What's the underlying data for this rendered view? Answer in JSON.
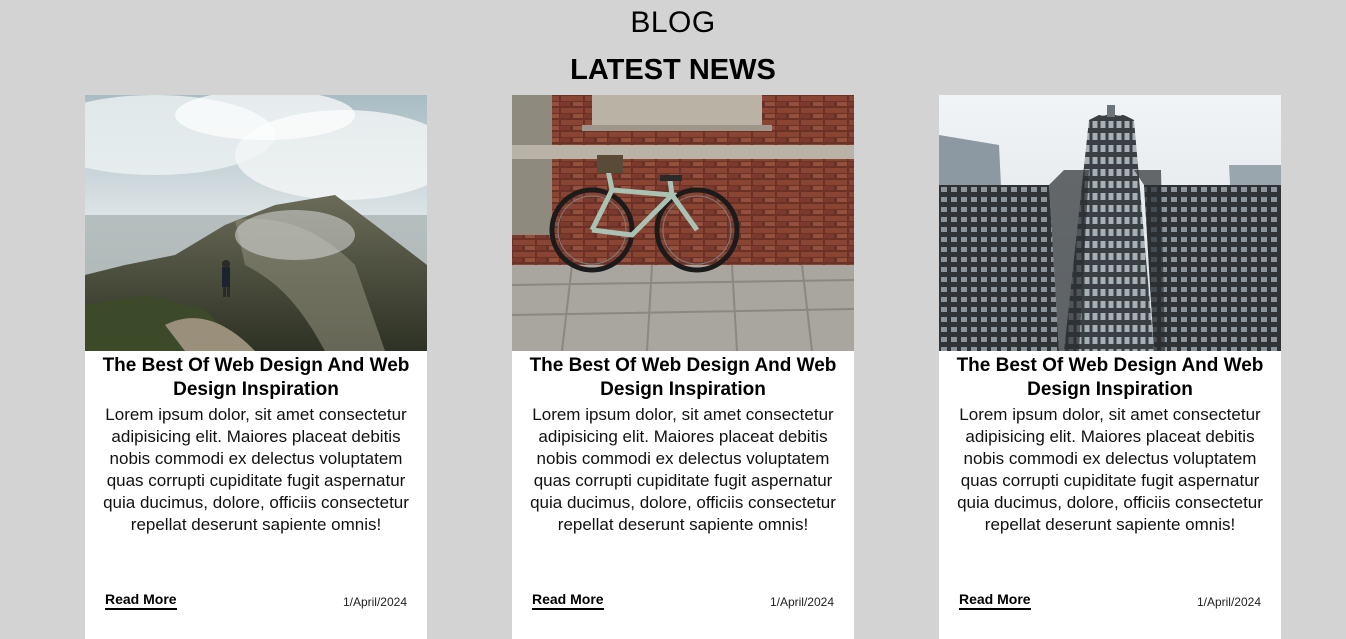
{
  "header": {
    "kicker": "BLOG",
    "title": "LATEST NEWS"
  },
  "cards": [
    {
      "image_subject": "hiker-on-mountain-trail",
      "title": "The Best Of Web Design And Web Design Inspiration",
      "body": "Lorem ipsum dolor, sit amet consectetur adipisicing elit. Maiores placeat debitis nobis commodi ex delectus voluptatem quas corrupti cupiditate fugit aspernatur quia ducimus, dolore, officiis consectetur repellat deserunt sapiente omnis!",
      "read_more": "Read More",
      "date": "1/April/2024"
    },
    {
      "image_subject": "bicycle-against-brick-wall",
      "title": "The Best Of Web Design And Web Design Inspiration",
      "body": "Lorem ipsum dolor, sit amet consectetur adipisicing elit. Maiores placeat debitis nobis commodi ex delectus voluptatem quas corrupti cupiditate fugit aspernatur quia ducimus, dolore, officiis consectetur repellat deserunt sapiente omnis!",
      "read_more": "Read More",
      "date": "1/April/2024"
    },
    {
      "image_subject": "skyscrapers-looking-up",
      "title": "The Best Of Web Design And Web Design Inspiration",
      "body": "Lorem ipsum dolor, sit amet consectetur adipisicing elit. Maiores placeat debitis nobis commodi ex delectus voluptatem quas corrupti cupiditate fugit aspernatur quia ducimus, dolore, officiis consectetur repellat deserunt sapiente omnis!",
      "read_more": "Read More",
      "date": "1/April/2024"
    }
  ]
}
